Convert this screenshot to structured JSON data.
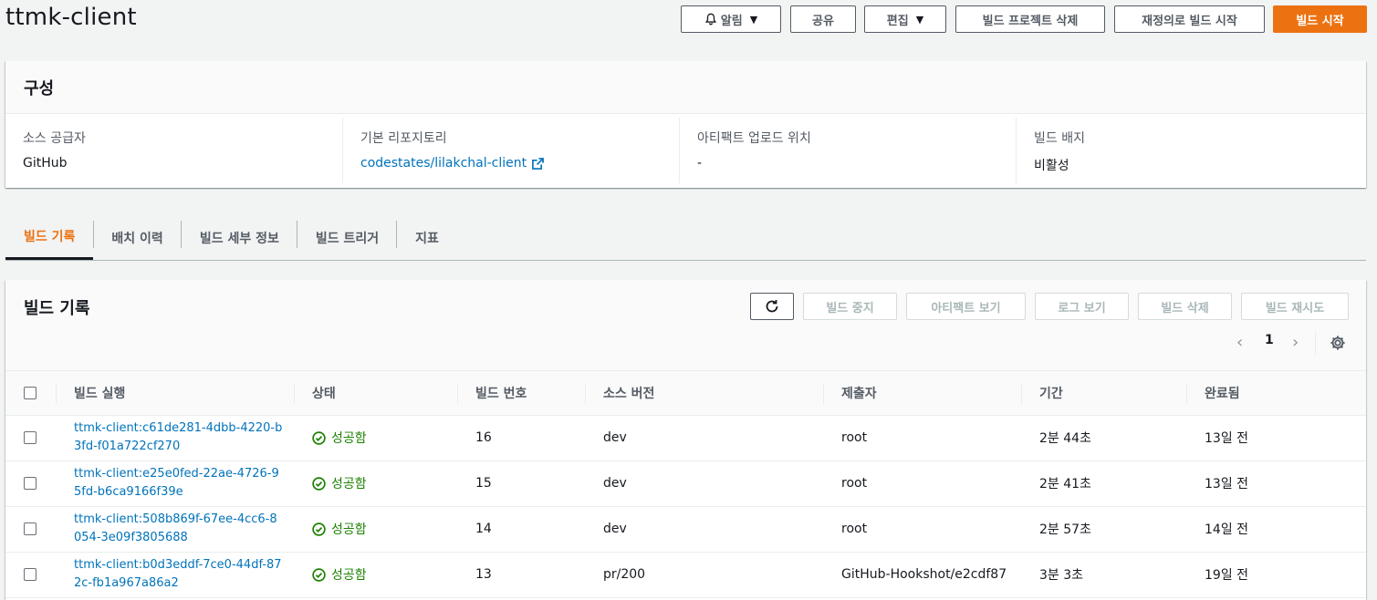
{
  "header": {
    "title": "ttmk-client",
    "buttons": {
      "notify": "알림",
      "share": "공유",
      "edit": "편집",
      "delete_project": "빌드 프로젝트 삭제",
      "start_with_overrides": "재정의로 빌드 시작",
      "start_build": "빌드 시작"
    }
  },
  "config": {
    "title": "구성",
    "fields": [
      {
        "label": "소스 공급자",
        "value": "GitHub"
      },
      {
        "label": "기본 리포지토리",
        "value": "codestates/lilakchal-client"
      },
      {
        "label": "아티팩트 업로드 위치",
        "value": "-"
      },
      {
        "label": "빌드 배지",
        "value": "비활성"
      }
    ]
  },
  "tabs": [
    "빌드 기록",
    "배치 이력",
    "빌드 세부 정보",
    "빌드 트리거",
    "지표"
  ],
  "history": {
    "title": "빌드 기록",
    "toolbar": {
      "stop": "빌드 중지",
      "view_artifacts": "아티팩트 보기",
      "view_logs": "로그 보기",
      "delete": "빌드 삭제",
      "retry": "빌드 재시도"
    },
    "pager": {
      "page": "1"
    },
    "columns": [
      "빌드 실행",
      "상태",
      "빌드 번호",
      "소스 버전",
      "제출자",
      "기간",
      "완료됨"
    ],
    "rows": [
      {
        "run": "ttmk-client:c61de281-4dbb-4220-b3fd-f01a722cf270",
        "status": "성공함",
        "number": "16",
        "source": "dev",
        "submitter": "root",
        "duration": "2분 44초",
        "completed": "13일 전"
      },
      {
        "run": "ttmk-client:e25e0fed-22ae-4726-95fd-b6ca9166f39e",
        "status": "성공함",
        "number": "15",
        "source": "dev",
        "submitter": "root",
        "duration": "2분 41초",
        "completed": "13일 전"
      },
      {
        "run": "ttmk-client:508b869f-67ee-4cc6-8054-3e09f3805688",
        "status": "성공함",
        "number": "14",
        "source": "dev",
        "submitter": "root",
        "duration": "2분 57초",
        "completed": "14일 전"
      },
      {
        "run": "ttmk-client:b0d3eddf-7ce0-44df-872c-fb1a967a86a2",
        "status": "성공함",
        "number": "13",
        "source": "pr/200",
        "submitter": "GitHub-Hookshot/e2cdf87",
        "duration": "3분 3초",
        "completed": "19일 전"
      }
    ]
  },
  "colors": {
    "accent": "#ec7211",
    "link": "#0073bb",
    "success": "#1d8102"
  }
}
